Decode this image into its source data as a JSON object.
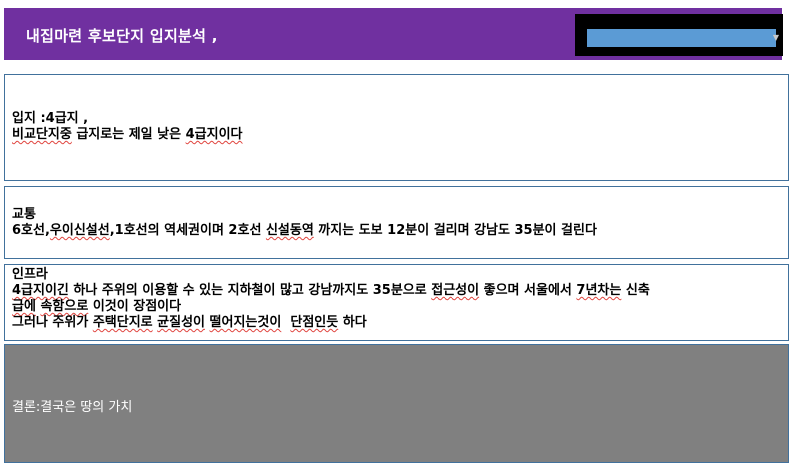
{
  "header": {
    "title": "내집마련 후보단지 입지분석 ,",
    "background_color": "#7030a0",
    "select_color": "#5b9bd5",
    "select_value": ""
  },
  "location_box": {
    "line1_label": "입지 :",
    "line1_grade": "4급지",
    "line1_tail": " ,",
    "line2_a": "비교단지중",
    "line2_b": " 급지로는 제일 낮은 ",
    "line2_c": "4급지이다"
  },
  "traffic_box": {
    "heading": "교통",
    "text_a": "6호선,",
    "text_b": "우이신설선",
    "text_c": ",1호선의 역세권이며 2호선 ",
    "text_d": "신설동역",
    "text_e": " 까지는 도보 12분이 걸리며 강남도 35분이 걸린다"
  },
  "infra_box": {
    "heading": "인프라",
    "line1_a": "4급지이긴",
    "line1_b": " 하나 주위의 이용할 수 있는 지하철이 많고 강남까지도 35분으로 ",
    "line1_c": "접근성이",
    "line1_d": " 좋으며 서울에서 ",
    "line1_e": "7년차는",
    "line1_f": " 신축",
    "line2_a": "급에",
    "line2_b": " ",
    "line2_c": "속함으로",
    "line2_d": " 이것이 장점이다",
    "line3_a": "그러나 주위가 ",
    "line3_b": "주택단지로",
    "line3_c": " ",
    "line3_d": "균질성이",
    "line3_e": " ",
    "line3_f": "떨어지는것이",
    "line3_g": "  ",
    "line3_h": "단점인듯",
    "line3_i": " 하다"
  },
  "conclusion": {
    "text": "결론:결국은 땅의 가치",
    "background_color": "#808080"
  }
}
